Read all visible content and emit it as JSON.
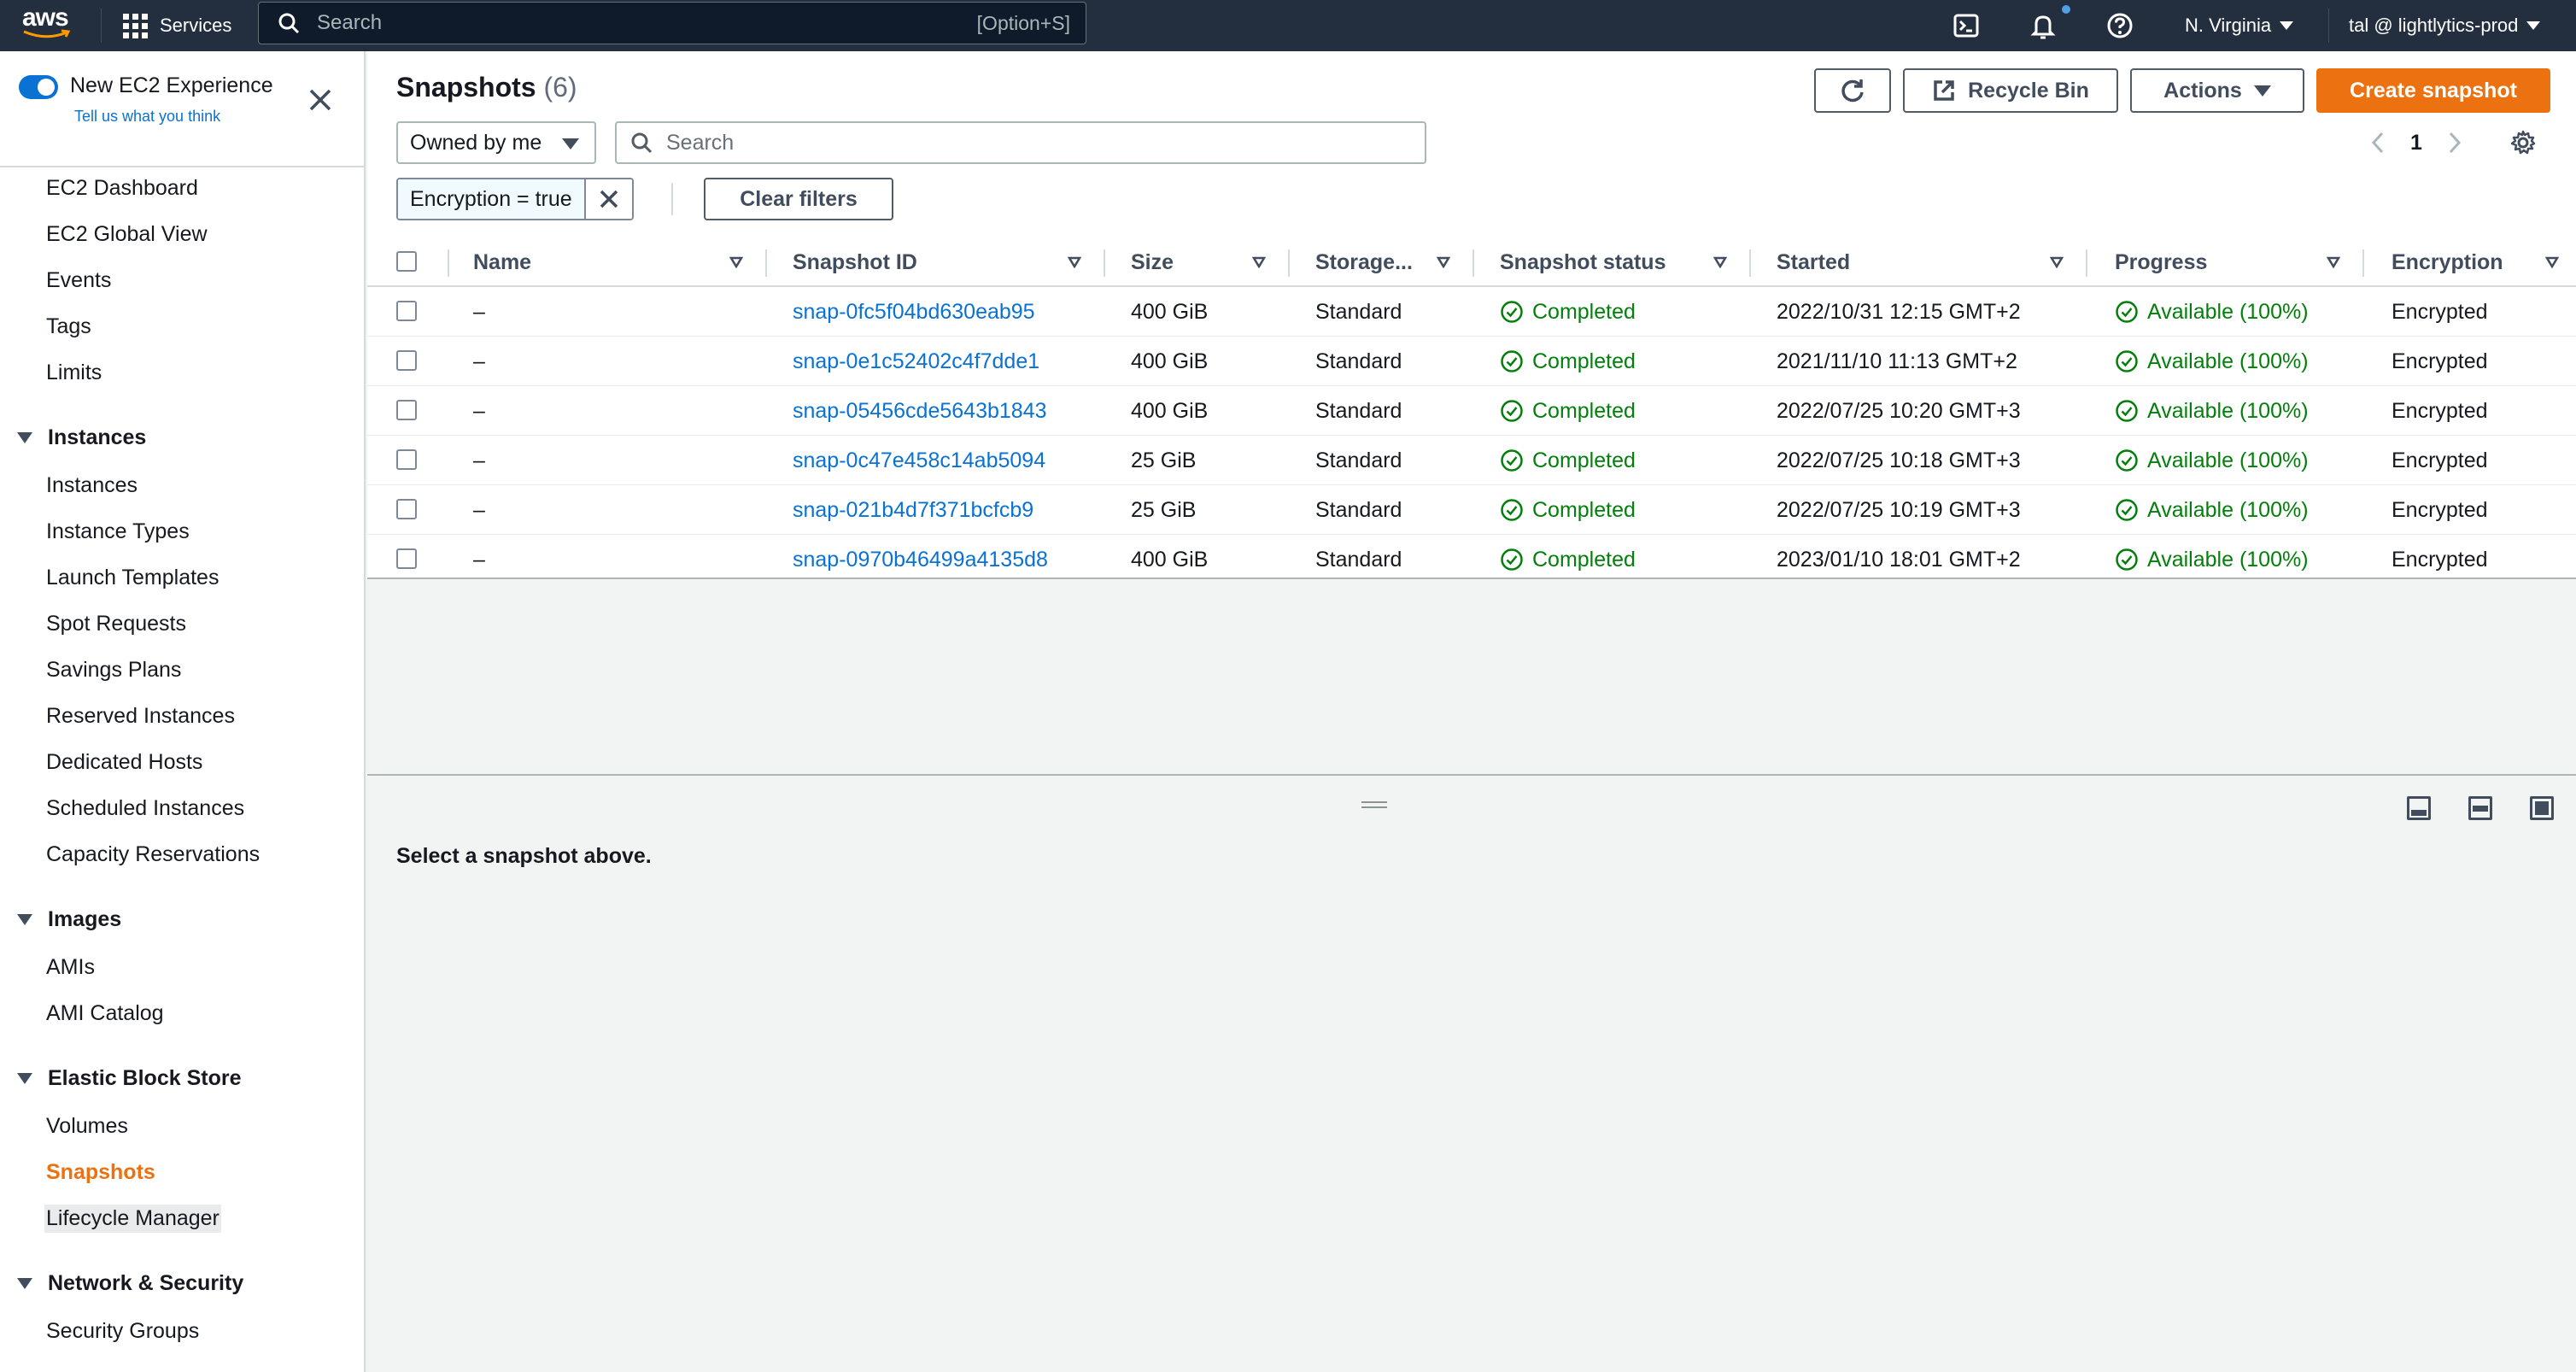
{
  "topnav": {
    "logo_text": "aws",
    "services_label": "Services",
    "search_placeholder": "Search",
    "search_shortcut": "[Option+S]",
    "region": "N. Virginia",
    "account": "tal @ lightlytics-prod"
  },
  "sidebar": {
    "experience_title": "New EC2 Experience",
    "experience_link": "Tell us what you think",
    "top_items": [
      "EC2 Dashboard",
      "EC2 Global View",
      "Events",
      "Tags",
      "Limits"
    ],
    "sections": [
      {
        "title": "Instances",
        "items": [
          "Instances",
          "Instance Types",
          "Launch Templates",
          "Spot Requests",
          "Savings Plans",
          "Reserved Instances",
          "Dedicated Hosts",
          "Scheduled Instances",
          "Capacity Reservations"
        ]
      },
      {
        "title": "Images",
        "items": [
          "AMIs",
          "AMI Catalog"
        ]
      },
      {
        "title": "Elastic Block Store",
        "items": [
          "Volumes",
          "Snapshots",
          "Lifecycle Manager"
        ]
      },
      {
        "title": "Network & Security",
        "items": [
          "Security Groups"
        ]
      }
    ],
    "active_item": "Snapshots"
  },
  "main": {
    "title": "Snapshots",
    "count": "(6)",
    "buttons": {
      "recycle_bin": "Recycle Bin",
      "actions": "Actions",
      "create": "Create snapshot",
      "clear_filters": "Clear filters"
    },
    "owner_filter": "Owned by me",
    "search_placeholder": "Search",
    "page_number": "1",
    "filter_token": "Encryption = true",
    "columns": [
      "Name",
      "Snapshot ID",
      "Size",
      "Storage...",
      "Snapshot status",
      "Started",
      "Progress",
      "Encryption"
    ],
    "rows": [
      {
        "name": "–",
        "id": "snap-0fc5f04bd630eab95",
        "size": "400 GiB",
        "storage": "Standard",
        "status": "Completed",
        "started": "2022/10/31 12:15 GMT+2",
        "progress": "Available (100%)",
        "encryption": "Encrypted"
      },
      {
        "name": "–",
        "id": "snap-0e1c52402c4f7dde1",
        "size": "400 GiB",
        "storage": "Standard",
        "status": "Completed",
        "started": "2021/11/10 11:13 GMT+2",
        "progress": "Available (100%)",
        "encryption": "Encrypted"
      },
      {
        "name": "–",
        "id": "snap-05456cde5643b1843",
        "size": "400 GiB",
        "storage": "Standard",
        "status": "Completed",
        "started": "2022/07/25 10:20 GMT+3",
        "progress": "Available (100%)",
        "encryption": "Encrypted"
      },
      {
        "name": "–",
        "id": "snap-0c47e458c14ab5094",
        "size": "25 GiB",
        "storage": "Standard",
        "status": "Completed",
        "started": "2022/07/25 10:18 GMT+3",
        "progress": "Available (100%)",
        "encryption": "Encrypted"
      },
      {
        "name": "–",
        "id": "snap-021b4d7f371bcfcb9",
        "size": "25 GiB",
        "storage": "Standard",
        "status": "Completed",
        "started": "2022/07/25 10:19 GMT+3",
        "progress": "Available (100%)",
        "encryption": "Encrypted"
      },
      {
        "name": "–",
        "id": "snap-0970b46499a4135d8",
        "size": "400 GiB",
        "storage": "Standard",
        "status": "Completed",
        "started": "2023/01/10 18:01 GMT+2",
        "progress": "Available (100%)",
        "encryption": "Encrypted"
      }
    ]
  },
  "split_panel": {
    "message": "Select a snapshot above."
  },
  "colors": {
    "nav_bg": "#232f3e",
    "accent": "#ec7211",
    "link": "#0972d3",
    "success": "#037f0c"
  },
  "icons": [
    "grid-icon",
    "search-icon",
    "cloudshell-icon",
    "bell-icon",
    "help-icon",
    "close-icon",
    "refresh-icon",
    "external-link-icon",
    "chevron-left-icon",
    "chevron-right-icon",
    "gear-icon",
    "check-circle-icon",
    "sort-icon"
  ]
}
